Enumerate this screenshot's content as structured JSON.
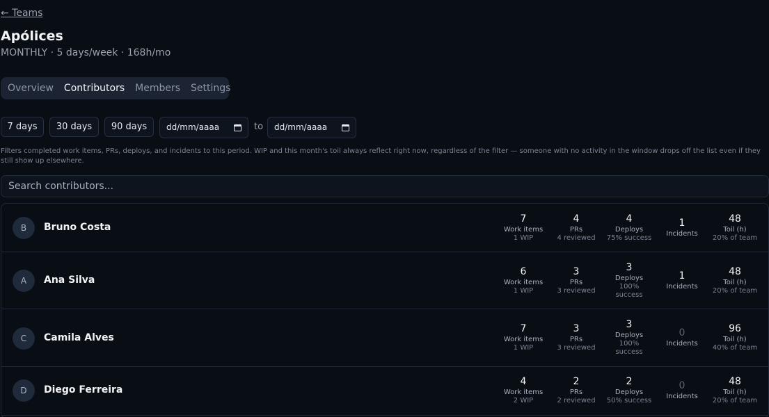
{
  "header": {
    "back_label": "← Teams",
    "title": "Apólices",
    "subtitle": "MONTHLY · 5 days/week · 168h/mo"
  },
  "tabs": [
    {
      "label": "Overview",
      "active": false
    },
    {
      "label": "Contributors",
      "active": true
    },
    {
      "label": "Members",
      "active": false
    },
    {
      "label": "Settings",
      "active": false
    }
  ],
  "filters": {
    "range_7": "7 days",
    "range_30": "30 days",
    "range_90": "90 days",
    "from_placeholder": "dd/mm/aaaa",
    "to_label": "to",
    "to_placeholder": "dd/mm/aaaa",
    "help_text": "Filters completed work items, PRs, deploys, and incidents to this period. WIP and this month's toil always reflect right now, regardless of the filter — someone with no activity in the window drops off the list even if they still show up elsewhere."
  },
  "search": {
    "placeholder": "Search contributors..."
  },
  "contributors": [
    {
      "initial": "B",
      "name": "Bruno Costa",
      "work_items": "7",
      "work_items_label": "Work items",
      "wip": "1 WIP",
      "prs": "4",
      "prs_label": "PRs",
      "reviewed": "4 reviewed",
      "deploys": "4",
      "deploys_label": "Deploys",
      "success": "75% success",
      "incidents": "1",
      "incidents_label": "Incidents",
      "toil": "48",
      "toil_label": "Toil (h)",
      "toil_share": "20% of team"
    },
    {
      "initial": "A",
      "name": "Ana Silva",
      "work_items": "6",
      "work_items_label": "Work items",
      "wip": "1 WIP",
      "prs": "3",
      "prs_label": "PRs",
      "reviewed": "3 reviewed",
      "deploys": "3",
      "deploys_label": "Deploys",
      "success": "100% success",
      "incidents": "1",
      "incidents_label": "Incidents",
      "toil": "48",
      "toil_label": "Toil (h)",
      "toil_share": "20% of team"
    },
    {
      "initial": "C",
      "name": "Camila Alves",
      "work_items": "7",
      "work_items_label": "Work items",
      "wip": "1 WIP",
      "prs": "3",
      "prs_label": "PRs",
      "reviewed": "3 reviewed",
      "deploys": "3",
      "deploys_label": "Deploys",
      "success": "100% success",
      "incidents": "0",
      "incidents_label": "Incidents",
      "toil": "96",
      "toil_label": "Toil (h)",
      "toil_share": "40% of team"
    },
    {
      "initial": "D",
      "name": "Diego Ferreira",
      "work_items": "4",
      "work_items_label": "Work items",
      "wip": "2 WIP",
      "prs": "2",
      "prs_label": "PRs",
      "reviewed": "2 reviewed",
      "deploys": "2",
      "deploys_label": "Deploys",
      "success": "50% success",
      "incidents": "0",
      "incidents_label": "Incidents",
      "toil": "48",
      "toil_label": "Toil (h)",
      "toil_share": "20% of team"
    }
  ]
}
